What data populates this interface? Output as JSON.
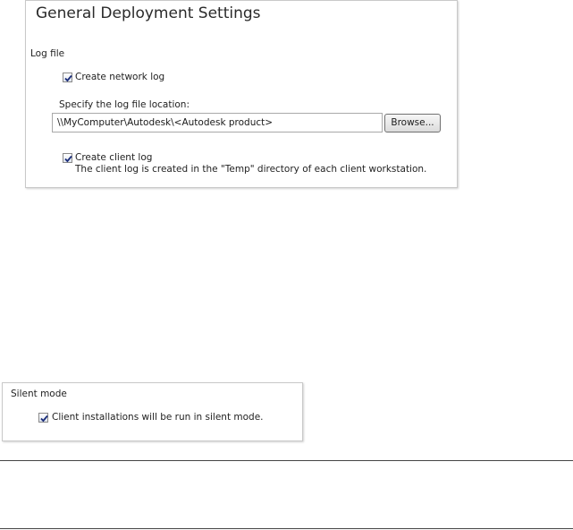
{
  "general": {
    "title": "General Deployment Settings",
    "log_section_label": "Log file",
    "create_network_log": {
      "label": "Create network log",
      "checked": true
    },
    "location_label": "Specify the log file location:",
    "location_value": "\\\\MyComputer\\Autodesk\\<Autodesk product>",
    "browse_label": "Browse...",
    "create_client_log": {
      "label": "Create client log",
      "checked": true
    },
    "client_log_note": "The client log is created in the \"Temp\" directory of each client workstation."
  },
  "silent": {
    "section_label": "Silent mode",
    "run_silent": {
      "label": "Client installations will be run in silent mode.",
      "checked": true
    }
  },
  "colors": {
    "check": "#1a2c7a",
    "border": "#c9c9c9"
  },
  "icons": {
    "checkmark": "checkmark-icon"
  }
}
